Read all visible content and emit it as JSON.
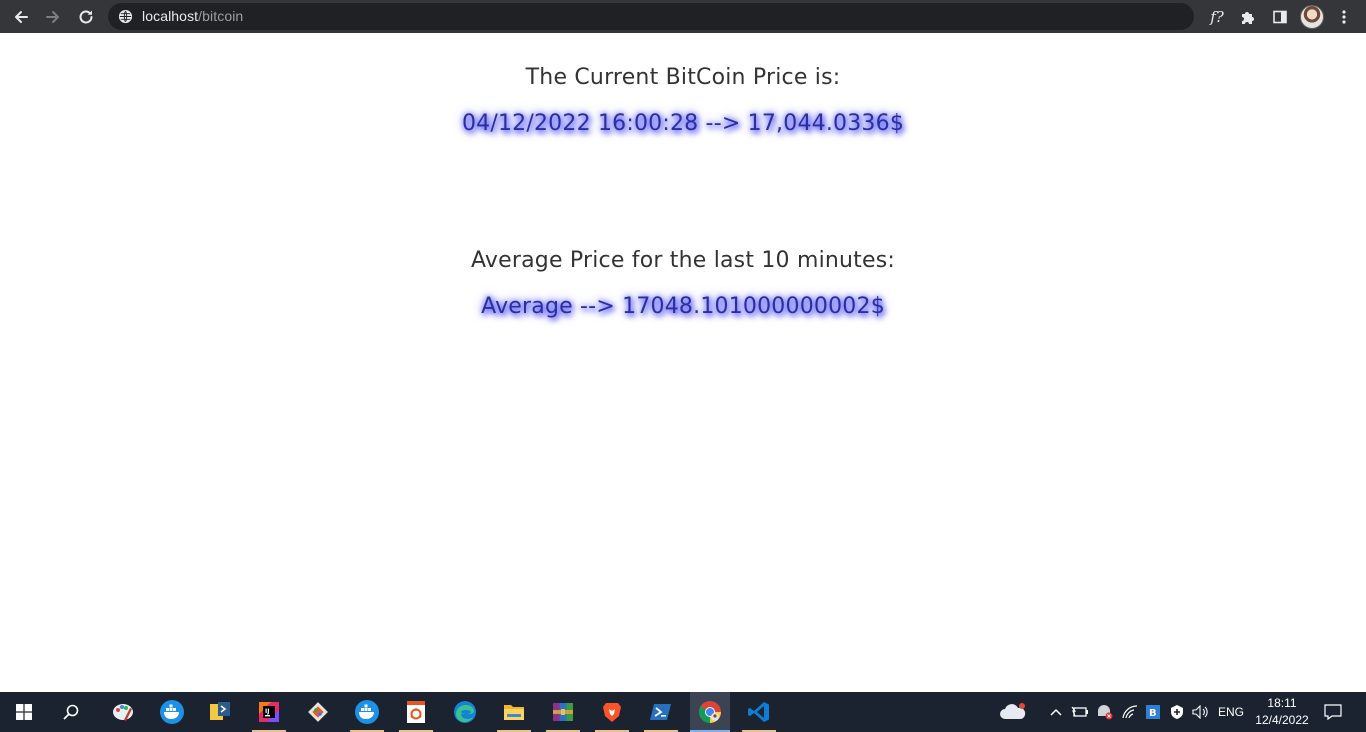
{
  "browser": {
    "url_host": "localhost",
    "url_path": "/bitcoin",
    "fq_label": "f?"
  },
  "page": {
    "current_heading": "The Current BitCoin Price is:",
    "current_value": "04/12/2022 16:00:28 --> 17,044.0336$",
    "average_heading": "Average Price for the last 10 minutes:",
    "average_value": "Average --> 17048.101000000002$"
  },
  "taskbar": {
    "apps": [
      "start-icon",
      "search-icon",
      "paint-icon",
      "docker-icon",
      "python-idle-icon",
      "intellij-icon",
      "git-icon",
      "docker-desktop-icon",
      "ubuntu-icon",
      "edge-icon",
      "file-explorer-icon",
      "winrar-icon",
      "brave-icon",
      "powershell-icon",
      "chrome-icon",
      "vscode-icon"
    ],
    "language": "ENG",
    "time": "18:11",
    "date": "12/4/2022"
  },
  "colors": {
    "chrome_bg": "#35363a",
    "omnibox_bg": "#202124",
    "price_color": "#2b2e9e",
    "taskbar_bg": "#1b2230"
  }
}
